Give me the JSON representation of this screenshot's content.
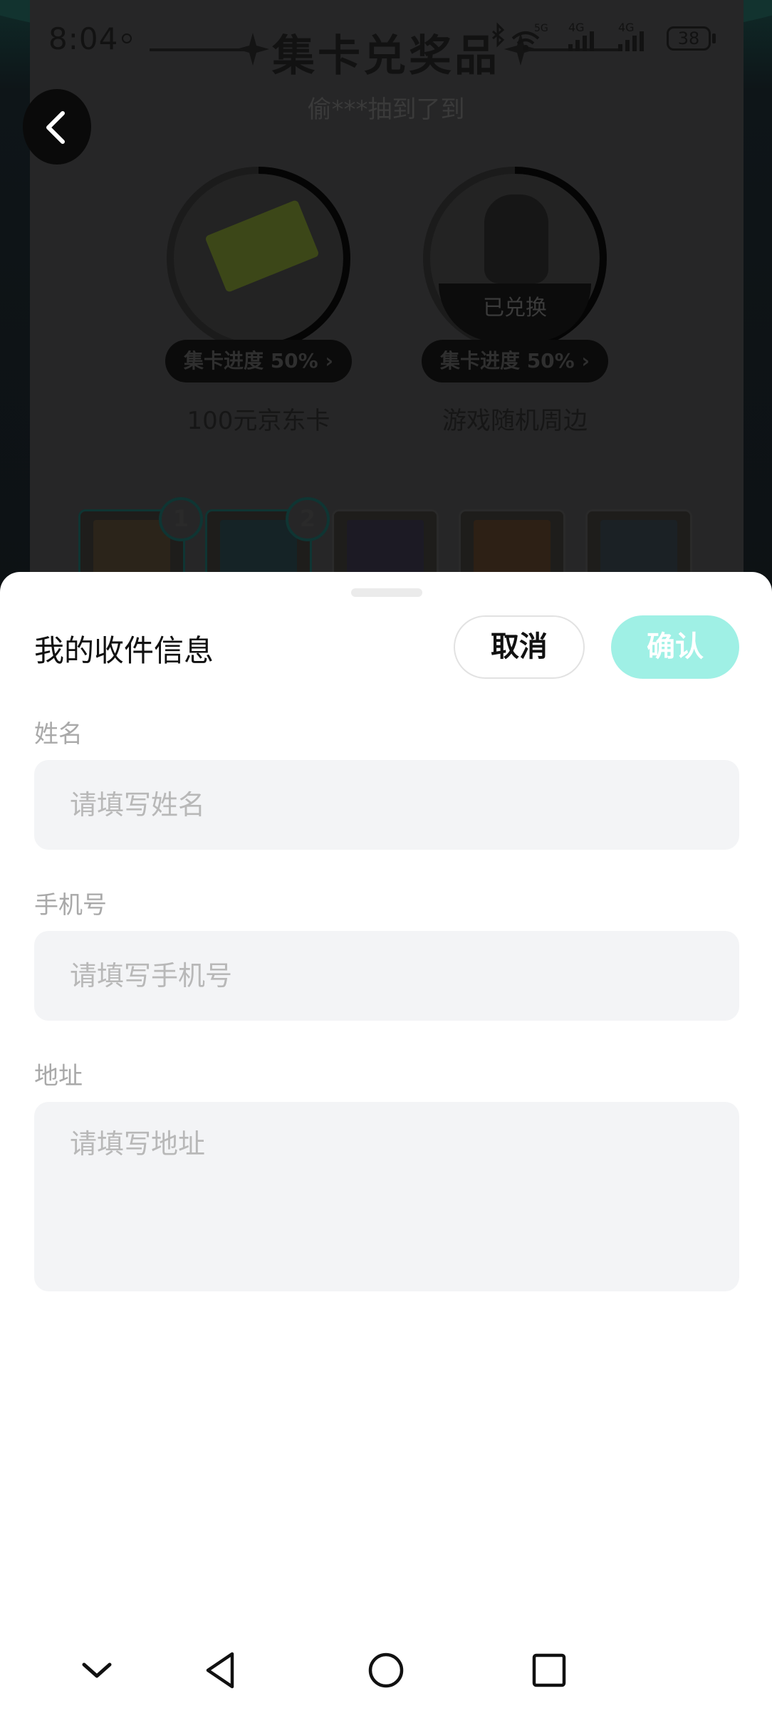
{
  "status_bar": {
    "time": "8:04",
    "battery": "38",
    "network_labels": [
      "5G",
      "4G",
      "4G"
    ]
  },
  "background_page": {
    "title": "集卡兑奖品",
    "subtitle": "偷***抽到了到",
    "prizes": [
      {
        "name": "100元京东卡",
        "progress_label": "集卡进度 50%",
        "progress": 0.5,
        "redeemed_label": ""
      },
      {
        "name": "游戏随机周边",
        "progress_label": "集卡进度 50%",
        "progress": 0.5,
        "redeemed_label": "已兑换"
      }
    ],
    "card_badges": [
      "1",
      "2"
    ]
  },
  "sheet": {
    "title": "我的收件信息",
    "cancel_label": "取消",
    "confirm_label": "确认",
    "fields": {
      "name": {
        "label": "姓名",
        "placeholder": "请填写姓名",
        "value": ""
      },
      "phone": {
        "label": "手机号",
        "placeholder": "请填写手机号",
        "value": ""
      },
      "address": {
        "label": "地址",
        "placeholder": "请填写地址",
        "value": ""
      }
    }
  },
  "colors": {
    "accent_disabled": "#9ff0e5",
    "field_background": "#f3f4f6",
    "label_gray": "#a9a9a9"
  },
  "icons": {
    "back": "chevron-left-icon",
    "nav_collapse": "chevron-down-icon",
    "nav_back": "triangle-back-icon",
    "nav_home": "circle-home-icon",
    "nav_recents": "square-recents-icon"
  }
}
